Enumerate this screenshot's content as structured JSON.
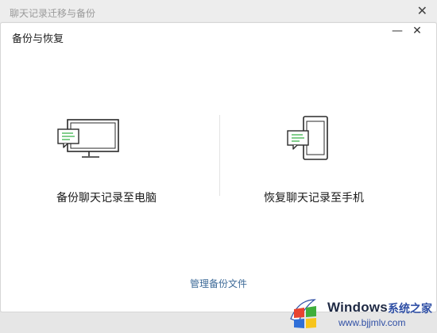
{
  "outer_window": {
    "title": "聊天记录迁移与备份",
    "close_glyph": "✕"
  },
  "dialog": {
    "title": "备份与恢复",
    "minimize_glyph": "—",
    "close_glyph": "✕"
  },
  "options": [
    {
      "label": "备份聊天记录至电脑",
      "icon": "monitor-chat-icon"
    },
    {
      "label": "恢复聊天记录至手机",
      "icon": "phone-chat-icon"
    }
  ],
  "manage_link": "管理备份文件",
  "watermark": {
    "brand": "Windows",
    "brand_cn": "系统之家",
    "url": "www.bjjmlv.com"
  },
  "colors": {
    "accent_green": "#3fb34f",
    "link_blue": "#3d6a98",
    "icon_stroke": "#2a2a2a"
  }
}
